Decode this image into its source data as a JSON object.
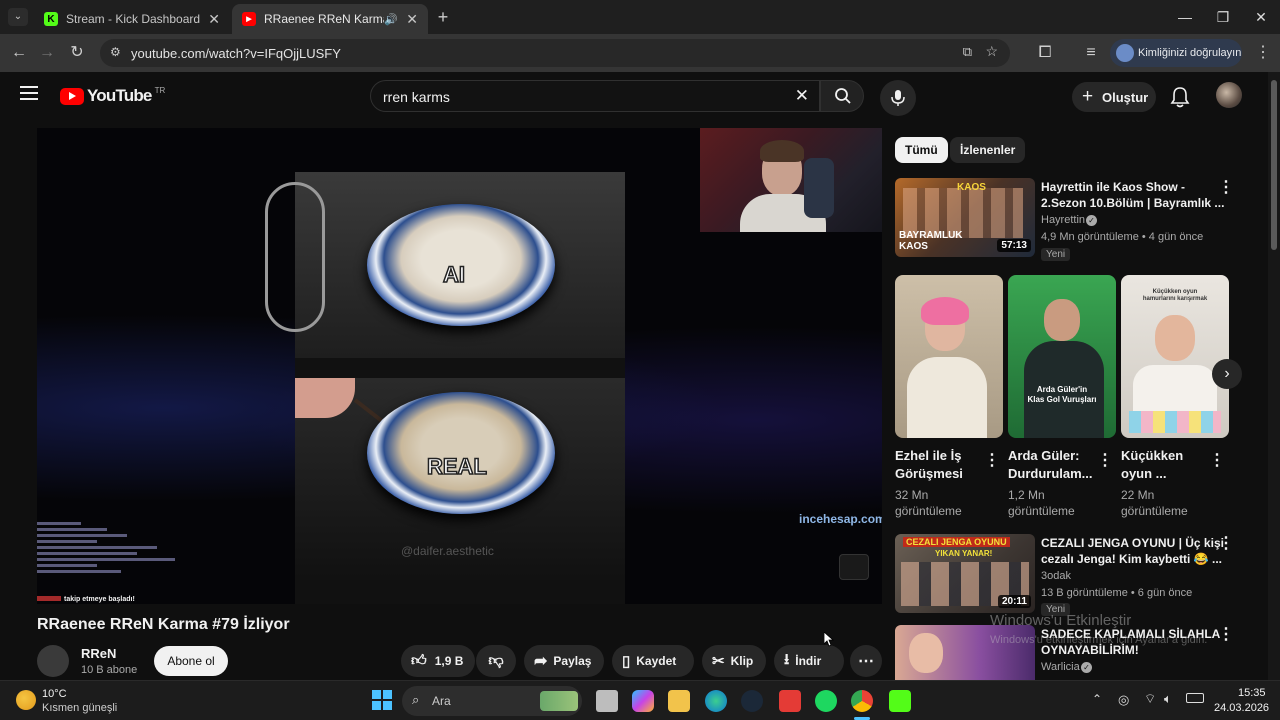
{
  "browser": {
    "tabs": [
      {
        "title": "Stream - Kick Dashboard",
        "icon": "kick-icon"
      },
      {
        "title": "RRaenee RReN Karma #79 |",
        "icon": "youtube-icon",
        "active": true
      }
    ],
    "url": "youtube.com/watch?v=IFqOjjLUSFY",
    "profile_label": "Kimliğinizi doğrulayın"
  },
  "youtube": {
    "logo_text": "YouTube",
    "logo_country": "TR",
    "search_value": "rren karms",
    "create_label": "Oluştur"
  },
  "player": {
    "overlay_ai": "AI",
    "overlay_real": "REAL",
    "watermark": "@daifer.aesthetic",
    "brand_watermark": "incehesap.com",
    "chat_line": "takip etmeye başladı!"
  },
  "video": {
    "title": "RRaenee RReN Karma #79 İzliyor",
    "channel": "RReN",
    "subscribers": "10 B abone",
    "subscribe_label": "Abone ol",
    "likes": "1,9 B",
    "share_label": "Paylaş",
    "save_label": "Kaydet",
    "clip_label": "Klip",
    "download_label": "İndir"
  },
  "sidebar": {
    "chips": [
      "Tümü",
      "İzlenenler"
    ],
    "video1": {
      "title_line1": "Hayrettin ile Kaos Show -",
      "title_line2": "2.Sezon 10.Bölüm | Bayramlık ...",
      "channel": "Hayrettin",
      "meta": "4,9 Mn görüntüleme • 4 gün önce",
      "badge": "Yeni",
      "duration": "57:13",
      "thumb_text1": "KAOS",
      "thumb_text2": "BAYRAMLUK",
      "thumb_text3": "KAOS"
    },
    "shorts": [
      {
        "title_line1": "Ezhel ile İş",
        "title_line2": "Görüşmesi",
        "views1": "32 Mn",
        "views2": "görüntüleme"
      },
      {
        "title_line1": "Arda Güler:",
        "title_line2": "Durdurulam...",
        "views1": "1,2 Mn",
        "views2": "görüntüleme",
        "thumb_text1": "Arda Güler'in",
        "thumb_text2": "Klas Gol Vuruşları"
      },
      {
        "title_line1": "Küçükken",
        "title_line2": "oyun ...",
        "views1": "22 Mn",
        "views2": "görüntüleme",
        "thumb_text1": "Küçükken oyun",
        "thumb_text2": "hamurlarını karışırmak"
      }
    ],
    "video2": {
      "title_line1": "CEZALI JENGA OYUNU | Üç kişi",
      "title_line2": "cezalı Jenga! Kim kaybetti 😂 ...",
      "channel": "3odak",
      "meta": "13 B görüntüleme • 6 gün önce",
      "badge": "Yeni",
      "duration": "20:11",
      "thumb_text1": "CEZALI JENGA OYUNU",
      "thumb_text2": "YIKAN YANAR!"
    },
    "video3": {
      "title_line1": "SADECE KAPLAMALI SİLAHLA",
      "title_line2": "OYNAYABİLİRİM!",
      "channel": "Warlicia"
    }
  },
  "windows_watermark": {
    "line1": "Windows'u Etkinleştir",
    "line2": "Windows'u etkinleştirmek için Ayarlar'a gidin."
  },
  "taskbar": {
    "weather_temp": "10°C",
    "weather_desc": "Kısmen güneşli",
    "search_placeholder": "Ara",
    "time": "15:35",
    "date": "24.03.2026"
  }
}
